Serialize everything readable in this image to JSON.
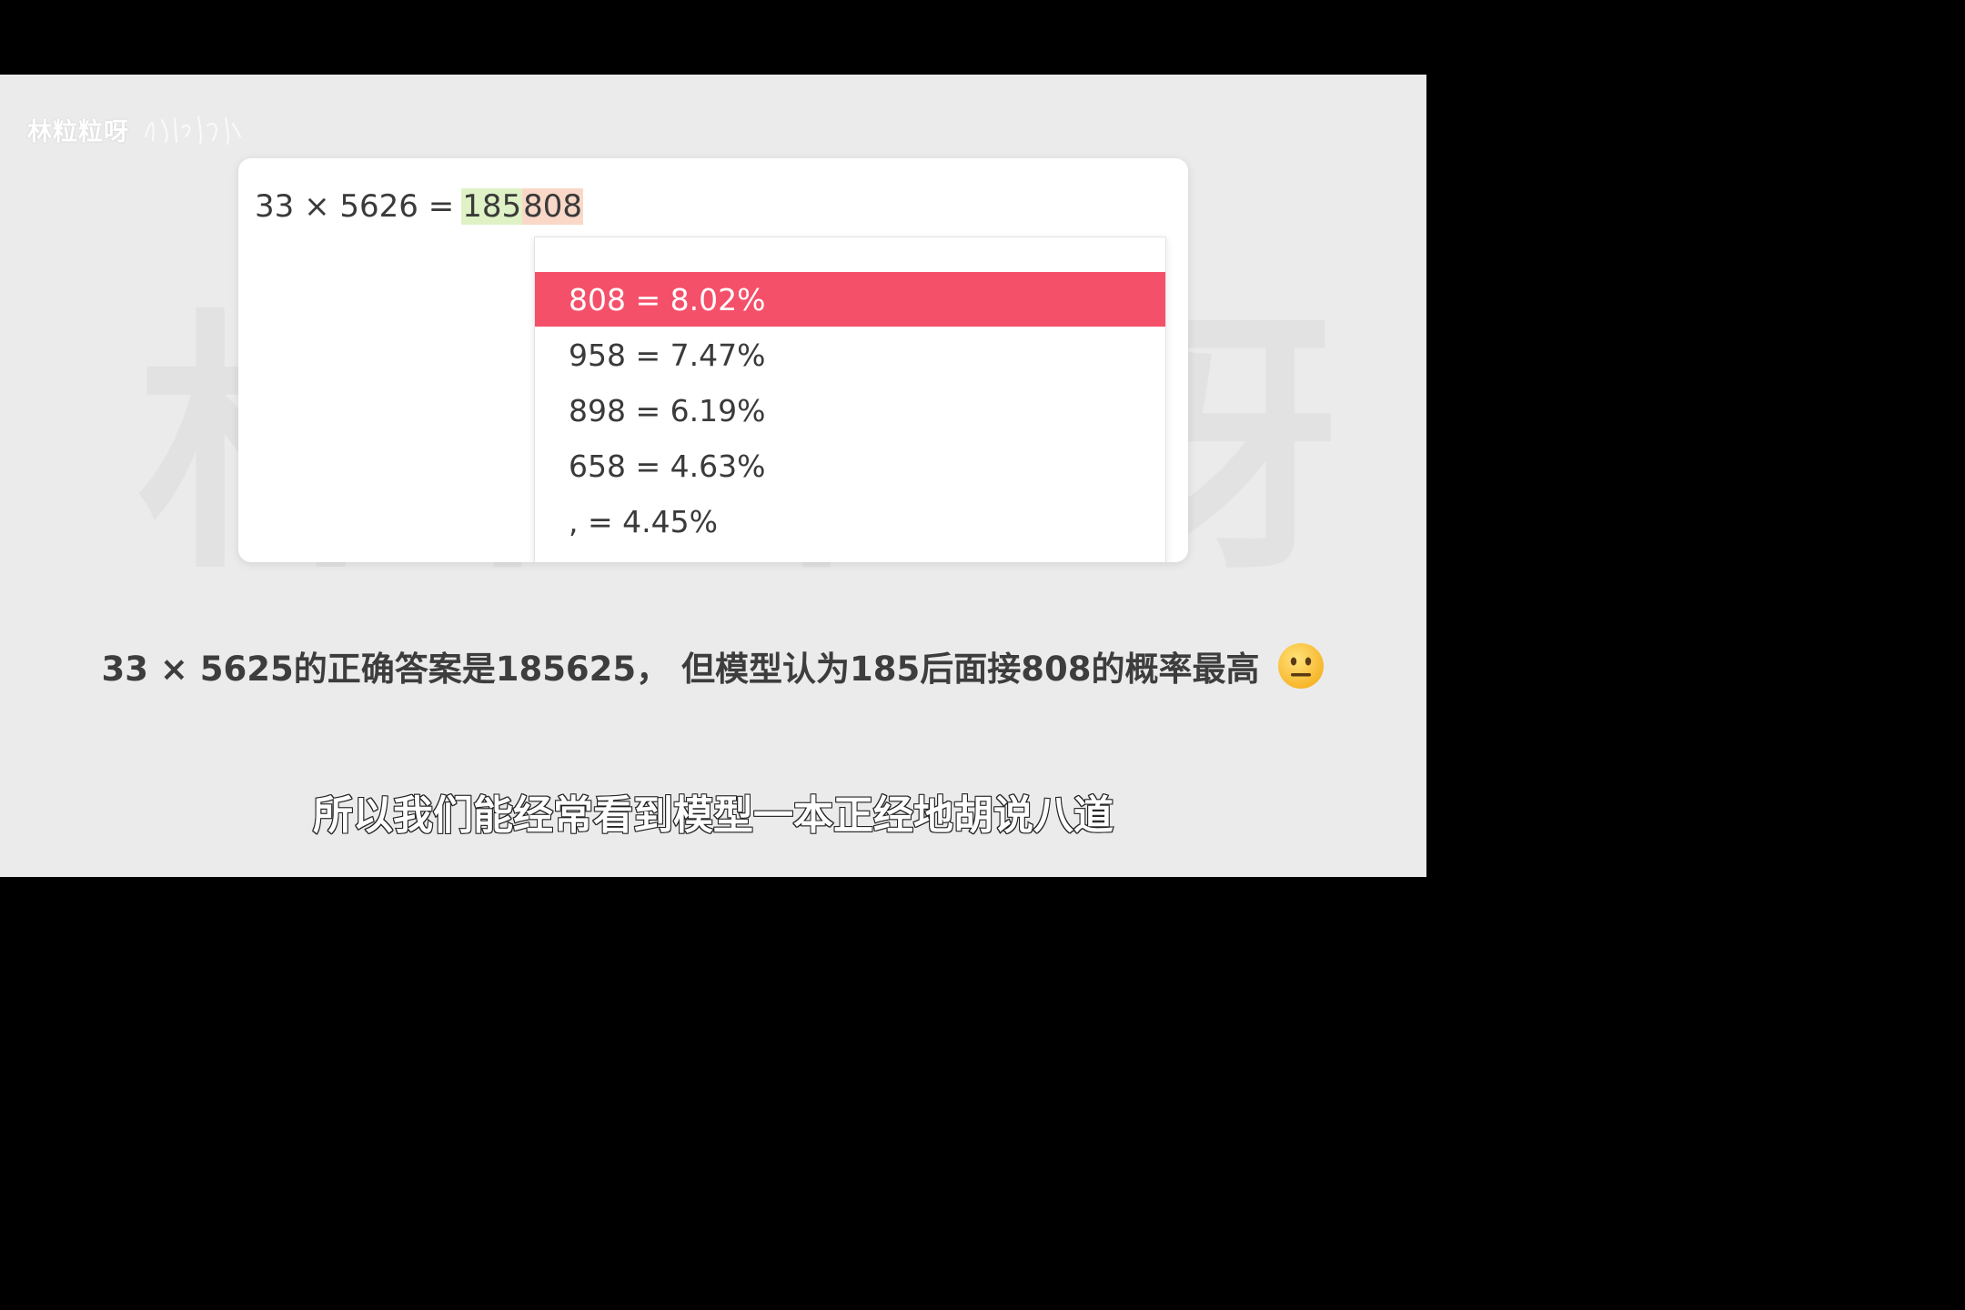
{
  "channel": {
    "name": "林粒粒呀",
    "signature_icon": "handwritten-signature"
  },
  "card": {
    "equation": {
      "prefix": "33 × 5626 =",
      "token_green": "185",
      "token_peach": "808"
    },
    "dropdown": {
      "options": [
        {
          "label": "808 = 8.02%",
          "selected": true
        },
        {
          "label": "958 = 7.47%",
          "selected": false
        },
        {
          "label": "898 = 6.19%",
          "selected": false
        },
        {
          "label": "658 = 4.63%",
          "selected": false
        },
        {
          "label": ", = 4.45%",
          "selected": false
        }
      ]
    }
  },
  "subtitle": {
    "text": "33 × 5625的正确答案是185625， 但模型认为185后面接808的概率最高",
    "emoji_icon": "neutral-face-icon"
  },
  "caption": {
    "text": "所以我们能经常看到模型一本正经地胡说八道"
  },
  "colors": {
    "selected_option": "#f5506a",
    "token_green": "#dff2c6",
    "token_peach": "#fad8c8",
    "stage_background": "#ebebeb"
  }
}
